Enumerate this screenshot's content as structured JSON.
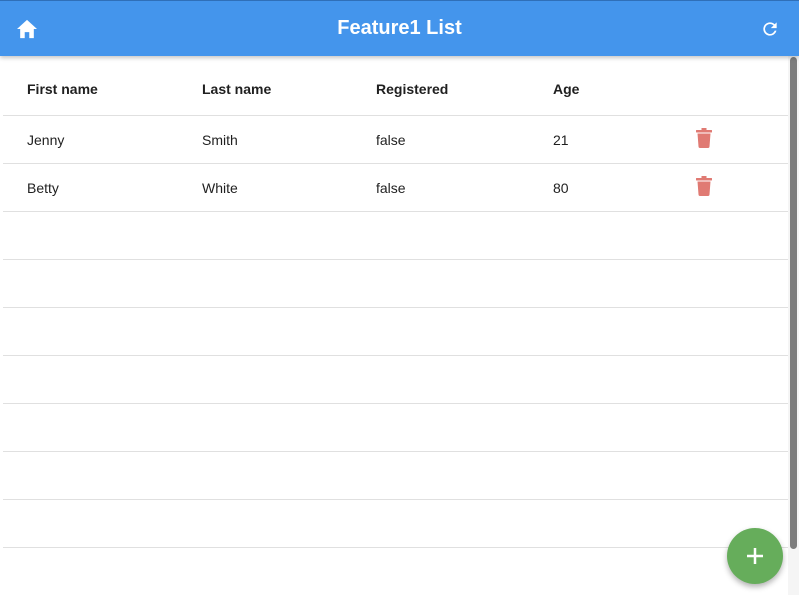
{
  "appbar": {
    "title": "Feature1 List",
    "color": "#4495ec",
    "left_icon": "home-icon",
    "right_icon": "refresh-icon"
  },
  "table": {
    "columns": [
      "First name",
      "Last name",
      "Registered",
      "Age"
    ],
    "rows": [
      {
        "first_name": "Jenny",
        "last_name": "Smith",
        "registered": "false",
        "age": "21"
      },
      {
        "first_name": "Betty",
        "last_name": "White",
        "registered": "false",
        "age": "80"
      }
    ],
    "row_action_icon": "trash-icon",
    "row_action_color": "#e07a73"
  },
  "fab": {
    "icon": "plus-icon",
    "color": "#66ad5b"
  }
}
